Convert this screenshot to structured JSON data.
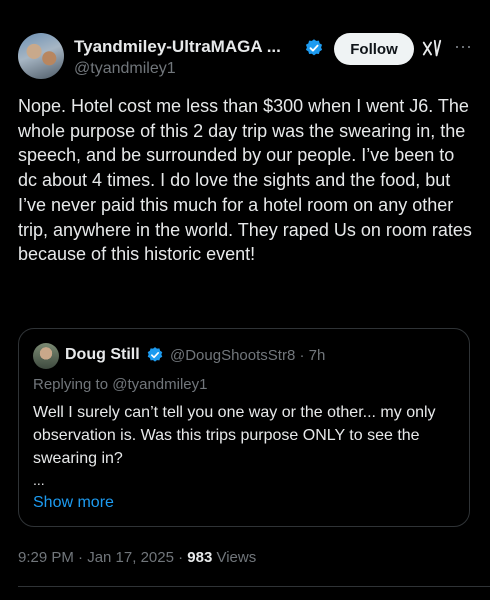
{
  "author": {
    "display_name": "Tyandmiley-UltraMAGA ...",
    "handle": "@tyandmiley1",
    "follow_label": "Follow"
  },
  "tweet": {
    "text": "Nope. Hotel cost me less than $300 when I went J6. The whole purpose of this 2 day trip was the swearing in, the speech, and be surrounded by our people. I’ve been to dc about 4 times. I do love the sights and the food, but I’ve never paid this much for a hotel room on any other trip, anywhere in the world. They raped Us on room rates because of this historic event!"
  },
  "quote": {
    "display_name": "Doug Still",
    "handle_time": "@DougShootsStr8 · 7h",
    "replying_to": "Replying to @tyandmiley1",
    "body": "Well I surely can’t tell you one way or the other... my only observation is. Was this trips purpose ONLY to see the swearing in?",
    "ellipsis": "...",
    "show_more": "Show more"
  },
  "meta": {
    "timestamp": "9:29 PM · Jan 17, 2025 · ",
    "views_count": "983",
    "views_label": " Views"
  },
  "colors": {
    "background": "#000000",
    "text": "#e7e9ea",
    "muted": "#71767b",
    "accent": "#1d9bf0",
    "verified": "#1d9bf0"
  },
  "icons": [
    "verified-badge-icon",
    "grok-icon",
    "more-options-icon"
  ]
}
